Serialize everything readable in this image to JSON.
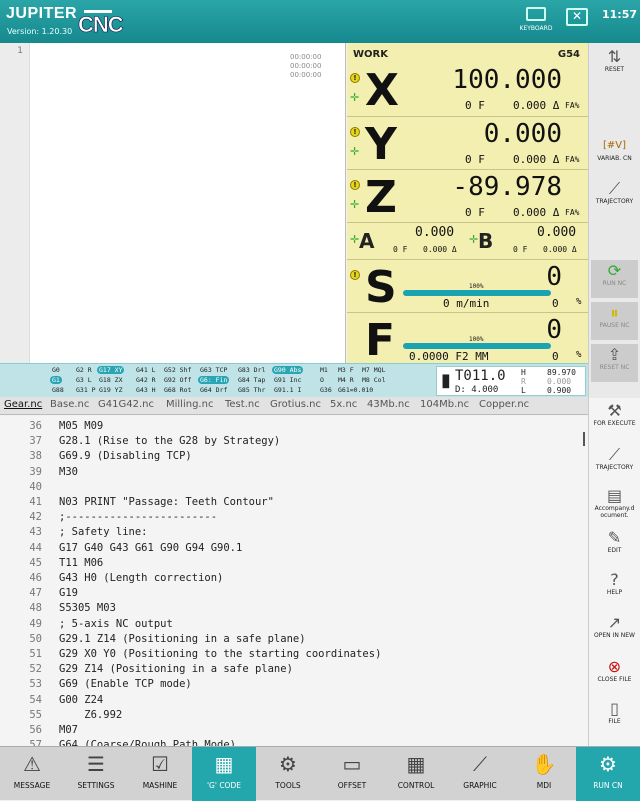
{
  "header": {
    "brand": "JUPITER",
    "version": "Version: 1.20.30",
    "logo": "CNC",
    "keyboard_label": "KEYBOARD",
    "clock": "11:57"
  },
  "editor_top": {
    "line": "1",
    "timers": [
      "00:00:00",
      "00:00:00",
      "00:00:00"
    ]
  },
  "work": {
    "title": "WORK",
    "coord": "G54",
    "x": {
      "letter": "X",
      "value": "100.000",
      "f": "0 F",
      "d": "0.000 Δ",
      "fa": "FA%"
    },
    "y": {
      "letter": "Y",
      "value": "0.000",
      "f": "0 F",
      "d": "0.000 Δ",
      "fa": "FA%"
    },
    "z": {
      "letter": "Z",
      "value": "-89.978",
      "f": "0 F",
      "d": "0.000 Δ",
      "fa": "FA%"
    },
    "a": {
      "letter": "A",
      "value": "0.000",
      "f": "0 F",
      "d": "0.000 Δ"
    },
    "b": {
      "letter": "B",
      "value": "0.000",
      "f": "0 F",
      "d": "0.000 Δ"
    },
    "s": {
      "letter": "S",
      "value": "0",
      "pct": "100%",
      "unit": "0 m/min",
      "pct2": "0",
      "percent_sign": "%",
      "fill": 1.0
    },
    "fd": {
      "letter": "F",
      "value": "0",
      "pct": "100%",
      "unit": "0.0000 F2 MM",
      "pct2": "0",
      "percent_sign": "%",
      "fill": 1.0
    }
  },
  "side_top": {
    "reset": "RESET",
    "variab": "VARIAB. CN",
    "variab_icon": "[#V]",
    "trajectory": "TRAJECTORY",
    "run": "RUN NC",
    "pause": "PAUSE NC",
    "reset_nc": "RESET NC"
  },
  "gcodes": {
    "row1": [
      "G0",
      "G2 R",
      "G17 XY",
      "G41 L",
      "G52 Shf",
      "G63 TCP",
      "G83 Drl",
      "G90 Abs",
      "M1",
      "M3 F",
      "M7 MQL"
    ],
    "row2": [
      "G1",
      "G3 L",
      "G18 ZX",
      "G42 R",
      "G92 Off",
      "G6: Fin",
      "G84 Tap",
      "G91 Inc",
      "O",
      "M4 R",
      "M8 Col"
    ],
    "row3": [
      "G88",
      "G31 P",
      "G19 YZ",
      "G43 H",
      "G68 Rot",
      "G64 Drf",
      "G85 Thr",
      "G91.1 I",
      "G36",
      "G61=0.010"
    ]
  },
  "tool": {
    "name": "T011.0",
    "d": "D: 4.000",
    "h_label": "H",
    "h_value": "89.970",
    "r_label": "R",
    "r_value": "0.000",
    "l_label": "L",
    "l_value": "0.900"
  },
  "tabs": [
    "Gear.nc",
    "Base.nc",
    "G41G42.nc",
    "Milling.nc",
    "Test.nc",
    "Grotius.nc",
    "5x.nc",
    "43Mb.nc",
    "104Mb.nc",
    "Copper.nc"
  ],
  "code": [
    {
      "n": "36",
      "t": "M05 M09"
    },
    {
      "n": "37",
      "t": "G28.1 (Rise to the G28 by Strategy)"
    },
    {
      "n": "38",
      "t": "G69.9 (Disabling TCP)"
    },
    {
      "n": "39",
      "t": "M30"
    },
    {
      "n": "40",
      "t": ""
    },
    {
      "n": "41",
      "t": "N03 PRINT \"Passage: Teeth Contour\""
    },
    {
      "n": "42",
      "t": ";------------------------"
    },
    {
      "n": "43",
      "t": "; Safety line:"
    },
    {
      "n": "44",
      "t": "G17 G40 G43 G61 G90 G94 G90.1"
    },
    {
      "n": "45",
      "t": "T11 M06"
    },
    {
      "n": "46",
      "t": "G43 H0 (Length correction)"
    },
    {
      "n": "47",
      "t": "G19"
    },
    {
      "n": "48",
      "t": "S5305 M03"
    },
    {
      "n": "49",
      "t": "; 5-axis NC output"
    },
    {
      "n": "50",
      "t": "G29.1 Z14 (Positioning in a safe plane)"
    },
    {
      "n": "51",
      "t": "G29 X0 Y0 (Positioning to the starting coordinates)"
    },
    {
      "n": "52",
      "t": "G29 Z14 (Positioning in a safe plane)"
    },
    {
      "n": "53",
      "t": "G69 (Enable TCP mode)"
    },
    {
      "n": "54",
      "t": "G00 Z24"
    },
    {
      "n": "55",
      "t": "    Z6.992"
    },
    {
      "n": "56",
      "t": "M07"
    },
    {
      "n": "57",
      "t": "G64 (Coarse/Rough Path Mode)"
    }
  ],
  "side_bottom": {
    "for_execute": "FOR EXECUTE",
    "trajectory": "TRAJECTORY",
    "accompany": "Accompany.d ocument.",
    "edit": "EDIT",
    "help": "HELP",
    "open": "OPEN IN NEW",
    "close_file": "CLOSE FILE",
    "file": "FILE"
  },
  "bottom": [
    "MESSAGE",
    "SETTINGS",
    "MASHINE",
    "'G' CODE",
    "TOOLS",
    "OFFSET",
    "CONTROL",
    "GRAPHIC",
    "MDI",
    "RUN CN"
  ]
}
